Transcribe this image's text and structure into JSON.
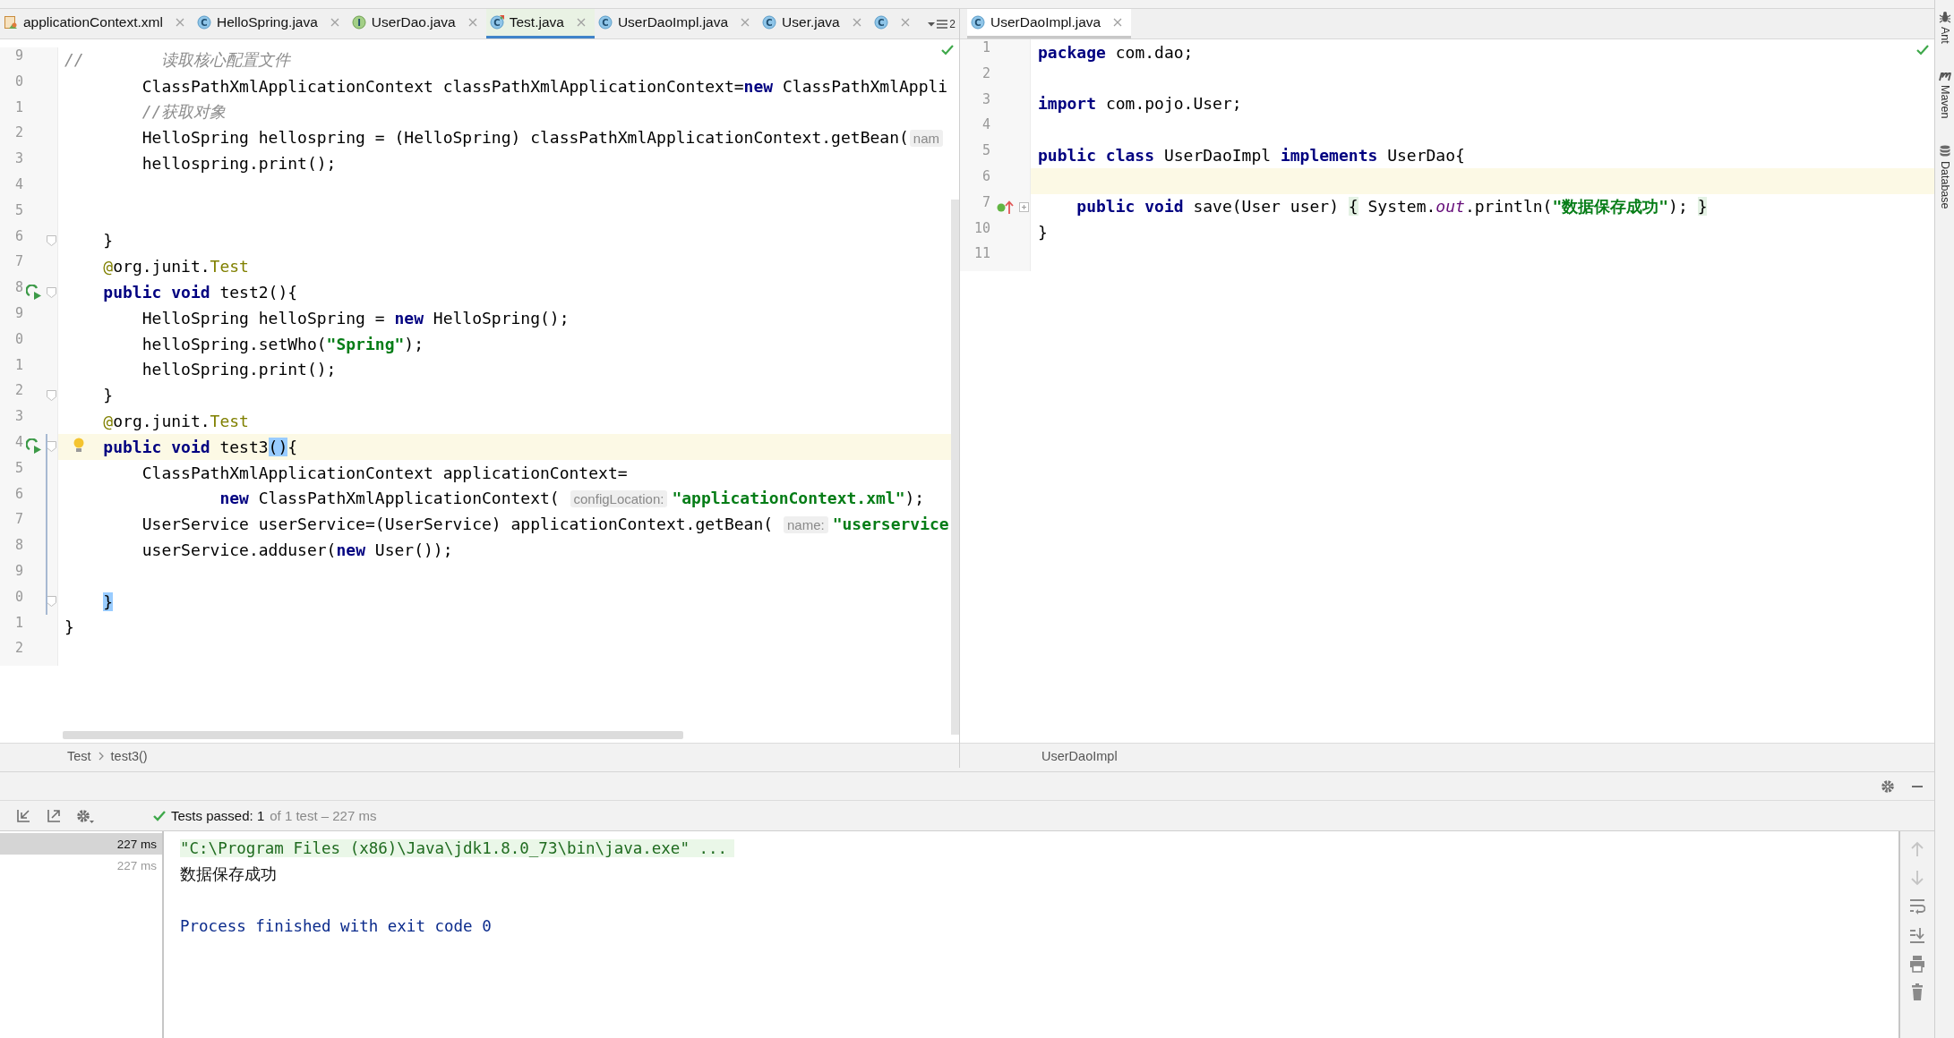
{
  "left_pane": {
    "focused": true,
    "tabs": [
      {
        "label": "applicationContext.xml",
        "kind": "xml",
        "selected": false
      },
      {
        "label": "HelloSpring.java",
        "kind": "class",
        "icon_text": "C",
        "selected": false
      },
      {
        "label": "UserDao.java",
        "kind": "interface",
        "icon_text": "I",
        "selected": false
      },
      {
        "label": "Test.java",
        "kind": "test_class",
        "icon_text": "C",
        "selected": true
      },
      {
        "label": "UserDaoImpl.java",
        "kind": "class",
        "icon_text": "C",
        "selected": false
      },
      {
        "label": "User.java",
        "kind": "class",
        "icon_text": "C",
        "selected": false
      },
      {
        "kind": "class",
        "icon_text": "C",
        "selected": false
      }
    ],
    "overflow": "2",
    "lines": [
      {
        "number": "9",
        "tokens": [
          {
            "kind": "comment",
            "text": "//        读取核心配置文件"
          }
        ]
      },
      {
        "number": "0",
        "tokens": [
          {
            "kind": "plain",
            "text": "        ClassPathXmlApplicationContext classPathXmlApplicationContext="
          },
          {
            "kind": "keyword",
            "text": "new"
          },
          {
            "kind": "plain",
            "text": " ClassPathXmlAppli"
          }
        ]
      },
      {
        "number": "1",
        "tokens": [
          {
            "kind": "comment",
            "text": "        //获取对象"
          }
        ]
      },
      {
        "number": "2",
        "tokens": [
          {
            "kind": "plain",
            "text": "        HelloSpring hellospring = (HelloSpring) classPathXmlApplicationContext.getBean("
          },
          {
            "kind": "hint",
            "text": "nam"
          }
        ]
      },
      {
        "number": "3",
        "tokens": [
          {
            "kind": "plain",
            "text": "        hellospring.print();"
          }
        ]
      },
      {
        "number": "4"
      },
      {
        "number": "5"
      },
      {
        "number": "6",
        "markers": [
          {
            "kind": "fold"
          }
        ],
        "tokens": [
          {
            "kind": "plain",
            "text": "    }"
          }
        ]
      },
      {
        "number": "7",
        "tokens": [
          {
            "kind": "annotation",
            "text": "    @"
          },
          {
            "kind": "plain",
            "text": "org.junit."
          },
          {
            "kind": "annotation",
            "text": "Test"
          }
        ]
      },
      {
        "number": "8",
        "markers": [
          {
            "kind": "run"
          },
          {
            "kind": "fold"
          }
        ],
        "tokens": [
          {
            "kind": "keyword",
            "text": "    public void"
          },
          {
            "kind": "plain",
            "text": " test2(){"
          }
        ]
      },
      {
        "number": "9",
        "tokens": [
          {
            "kind": "plain",
            "text": "        HelloSpring helloSpring = "
          },
          {
            "kind": "keyword",
            "text": "new"
          },
          {
            "kind": "plain",
            "text": " HelloSpring();"
          }
        ]
      },
      {
        "number": "0",
        "tokens": [
          {
            "kind": "plain",
            "text": "        helloSpring.setWho("
          },
          {
            "kind": "string",
            "text": "\"Spring\""
          },
          {
            "kind": "plain",
            "text": ");"
          }
        ]
      },
      {
        "number": "1",
        "tokens": [
          {
            "kind": "plain",
            "text": "        helloSpring.print();"
          }
        ]
      },
      {
        "number": "2",
        "markers": [
          {
            "kind": "fold"
          }
        ],
        "tokens": [
          {
            "kind": "plain",
            "text": "    }"
          }
        ]
      },
      {
        "number": "3",
        "tokens": [
          {
            "kind": "annotation",
            "text": "    @"
          },
          {
            "kind": "plain",
            "text": "org.junit."
          },
          {
            "kind": "annotation",
            "text": "Test"
          }
        ]
      },
      {
        "number": "4",
        "markers": [
          {
            "kind": "run"
          },
          {
            "kind": "fold"
          },
          {
            "kind": "bulb"
          },
          {
            "kind": "caret_line"
          },
          {
            "kind": "changed"
          }
        ],
        "tokens": [
          {
            "kind": "keyword",
            "text": "    public void"
          },
          {
            "kind": "plain",
            "text": " test3"
          },
          {
            "kind": "match",
            "text": "()"
          },
          {
            "kind": "plain",
            "text": "{"
          }
        ]
      },
      {
        "number": "5",
        "markers": [
          {
            "kind": "changed"
          }
        ],
        "tokens": [
          {
            "kind": "plain",
            "text": "        ClassPathXmlApplicationContext applicationContext="
          }
        ]
      },
      {
        "number": "6",
        "markers": [
          {
            "kind": "changed"
          }
        ],
        "tokens": [
          {
            "kind": "keyword",
            "text": "                new"
          },
          {
            "kind": "plain",
            "text": " ClassPathXmlApplicationContext( "
          },
          {
            "kind": "hint",
            "text": "configLocation:"
          },
          {
            "kind": "string",
            "text": "\"applicationContext.xml\""
          },
          {
            "kind": "plain",
            "text": ");"
          }
        ]
      },
      {
        "number": "7",
        "markers": [
          {
            "kind": "changed"
          }
        ],
        "tokens": [
          {
            "kind": "plain",
            "text": "        UserService userService=(UserService) applicationContext.getBean( "
          },
          {
            "kind": "hint",
            "text": "name:"
          },
          {
            "kind": "string",
            "text": "\"userservice"
          }
        ]
      },
      {
        "number": "8",
        "markers": [
          {
            "kind": "changed"
          }
        ],
        "tokens": [
          {
            "kind": "plain",
            "text": "        userService.adduser("
          },
          {
            "kind": "keyword",
            "text": "new"
          },
          {
            "kind": "plain",
            "text": " User());"
          }
        ]
      },
      {
        "number": "9",
        "markers": [
          {
            "kind": "changed"
          }
        ]
      },
      {
        "number": "0",
        "markers": [
          {
            "kind": "fold"
          },
          {
            "kind": "changed"
          }
        ],
        "tokens": [
          {
            "kind": "match",
            "text": "    }"
          }
        ]
      },
      {
        "number": "1",
        "tokens": [
          {
            "kind": "plain",
            "text": "}"
          }
        ]
      },
      {
        "number": "2"
      }
    ],
    "breadcrumb": [
      "Test",
      "test3()"
    ]
  },
  "right_pane": {
    "focused": false,
    "tabs": [
      {
        "label": "UserDaoImpl.java",
        "kind": "class",
        "icon_text": "C",
        "selected": true
      }
    ],
    "lines": [
      {
        "number": "1",
        "tokens": [
          {
            "kind": "keyword",
            "text": "package"
          },
          {
            "kind": "plain",
            "text": " com.dao;"
          }
        ]
      },
      {
        "number": "2"
      },
      {
        "number": "3",
        "tokens": [
          {
            "kind": "keyword",
            "text": "import"
          },
          {
            "kind": "plain",
            "text": " com.pojo.User;"
          }
        ]
      },
      {
        "number": "4"
      },
      {
        "number": "5",
        "tokens": [
          {
            "kind": "keyword",
            "text": "public class"
          },
          {
            "kind": "plain",
            "text": " UserDaoImpl "
          },
          {
            "kind": "keyword",
            "text": "implements"
          },
          {
            "kind": "plain",
            "text": " UserDao{"
          }
        ]
      },
      {
        "number": "6",
        "markers": [
          {
            "kind": "caret_line"
          }
        ]
      },
      {
        "number": "7",
        "markers": [
          {
            "kind": "implements"
          },
          {
            "kind": "fold_plus"
          }
        ],
        "tokens": [
          {
            "kind": "keyword",
            "text": "    public void"
          },
          {
            "kind": "plain",
            "text": " save(User user) "
          },
          {
            "kind": "fold_brace",
            "text": "{"
          },
          {
            "kind": "plain",
            "text": " System."
          },
          {
            "kind": "static",
            "text": "out"
          },
          {
            "kind": "plain",
            "text": ".println("
          },
          {
            "kind": "string",
            "text": "\"数据保存成功\""
          },
          {
            "kind": "plain",
            "text": "); "
          },
          {
            "kind": "fold_brace",
            "text": "}"
          }
        ]
      },
      {
        "number": "10",
        "tokens": [
          {
            "kind": "plain",
            "text": "}"
          }
        ]
      },
      {
        "number": "11"
      }
    ],
    "breadcrumb": [
      "UserDaoImpl"
    ]
  },
  "run_panel": {
    "status": "Tests passed: 1",
    "status_detail": "of 1 test – 227 ms",
    "tests": [
      {
        "duration": "227 ms",
        "selected": true
      },
      {
        "duration": "227 ms",
        "selected": false
      }
    ],
    "console": [
      {
        "kind": "command",
        "text": "\"C:\\Program Files (x86)\\Java\\jdk1.8.0_73\\bin\\java.exe\" ..."
      },
      {
        "kind": "output",
        "text": "数据保存成功"
      },
      {
        "kind": "blank"
      },
      {
        "kind": "system",
        "text": "Process finished with exit code 0"
      }
    ]
  },
  "side_tools": [
    {
      "label": "Ant",
      "kind": "ant"
    },
    {
      "label": "Maven",
      "kind": "maven"
    },
    {
      "label": "Database",
      "kind": "database"
    }
  ]
}
